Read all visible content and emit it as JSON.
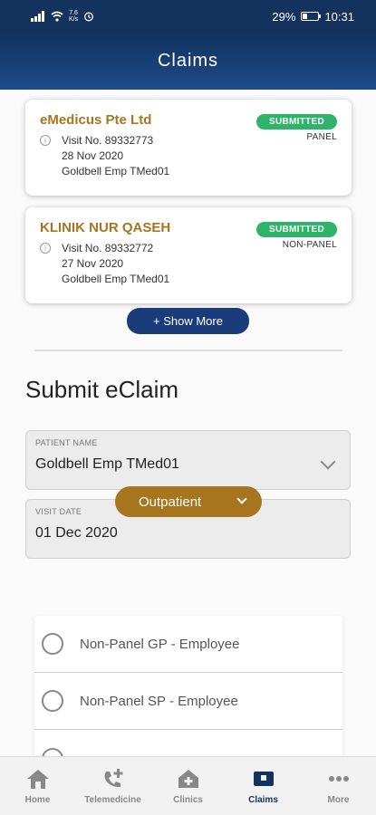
{
  "status_bar": {
    "speed_value": "7.6",
    "speed_unit": "K/s",
    "battery": "29%",
    "battery_level": 0.29,
    "time": "10:31"
  },
  "header": {
    "title": "Claims"
  },
  "claims": [
    {
      "clinic": "eMedicus Pte Ltd",
      "visit_no": "Visit No. 89332773",
      "date": "28 Nov 2020",
      "patient": "Goldbell Emp TMed01",
      "status": "SUBMITTED",
      "type": "PANEL"
    },
    {
      "clinic": "KLINIK NUR QASEH",
      "visit_no": "Visit No. 89332772",
      "date": "27 Nov 2020",
      "patient": "Goldbell Emp TMed01",
      "status": "SUBMITTED",
      "type": "NON-PANEL"
    }
  ],
  "show_more_label": "+ Show More",
  "submit": {
    "title": "Submit eClaim",
    "patient_label": "PATIENT NAME",
    "patient_value": "Goldbell Emp TMed01",
    "visit_date_label": "VISIT DATE",
    "visit_date_value": "01 Dec 2020",
    "category": "Outpatient",
    "options": [
      "Non-Panel GP - Employee",
      "Non-Panel SP - Employee"
    ]
  },
  "bottom_nav": [
    {
      "label": "Home",
      "icon": "home-icon"
    },
    {
      "label": "Telemedicine",
      "icon": "telemedicine-icon"
    },
    {
      "label": "Clinics",
      "icon": "clinics-icon"
    },
    {
      "label": "Claims",
      "icon": "claims-icon",
      "active": true
    },
    {
      "label": "More",
      "icon": "more-icon"
    }
  ],
  "colors": {
    "primary": "#13325e",
    "accent_gold": "#a8751f",
    "status_green": "#2db36a",
    "button_blue": "#1a3c7a"
  }
}
